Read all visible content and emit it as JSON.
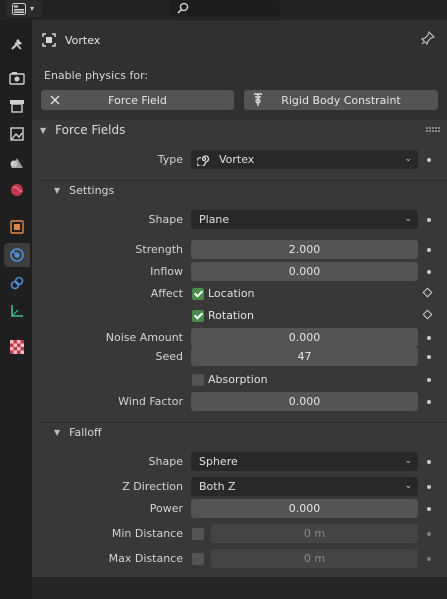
{
  "header": {
    "search_placeholder": ""
  },
  "tabs": [
    {
      "icon": "tool-icon"
    },
    {
      "icon": "render-icon"
    },
    {
      "icon": "output-icon"
    },
    {
      "icon": "view-layer-icon"
    },
    {
      "icon": "scene-icon"
    },
    {
      "icon": "world-icon"
    },
    {
      "icon": "object-icon"
    },
    {
      "icon": "physics-icon",
      "active": true
    },
    {
      "icon": "constraint-icon"
    },
    {
      "icon": "data-icon"
    },
    {
      "icon": "texture-icon"
    }
  ],
  "object": {
    "name": "Vortex"
  },
  "enable": {
    "label": "Enable physics for:",
    "force_field": "Force Field",
    "rigid_body_constraint": "Rigid Body Constraint"
  },
  "force_fields": {
    "title": "Force Fields",
    "type_label": "Type",
    "type_value": "Vortex"
  },
  "settings": {
    "title": "Settings",
    "shape_label": "Shape",
    "shape_value": "Plane",
    "strength_label": "Strength",
    "strength_value": "2.000",
    "inflow_label": "Inflow",
    "inflow_value": "0.000",
    "affect_label": "Affect",
    "location_label": "Location",
    "location_checked": true,
    "rotation_label": "Rotation",
    "rotation_checked": true,
    "noise_label": "Noise Amount",
    "noise_value": "0.000",
    "seed_label": "Seed",
    "seed_value": "47",
    "absorption_label": "Absorption",
    "absorption_checked": false,
    "wind_label": "Wind Factor",
    "wind_value": "0.000"
  },
  "falloff": {
    "title": "Falloff",
    "shape_label": "Shape",
    "shape_value": "Sphere",
    "zdir_label": "Z Direction",
    "zdir_value": "Both Z",
    "power_label": "Power",
    "power_value": "0.000",
    "min_label": "Min Distance",
    "min_value": "0 m",
    "max_label": "Max Distance",
    "max_value": "0 m"
  },
  "colors": {
    "accent_blue": "#4772b3",
    "check_green": "#4a8a4a"
  }
}
